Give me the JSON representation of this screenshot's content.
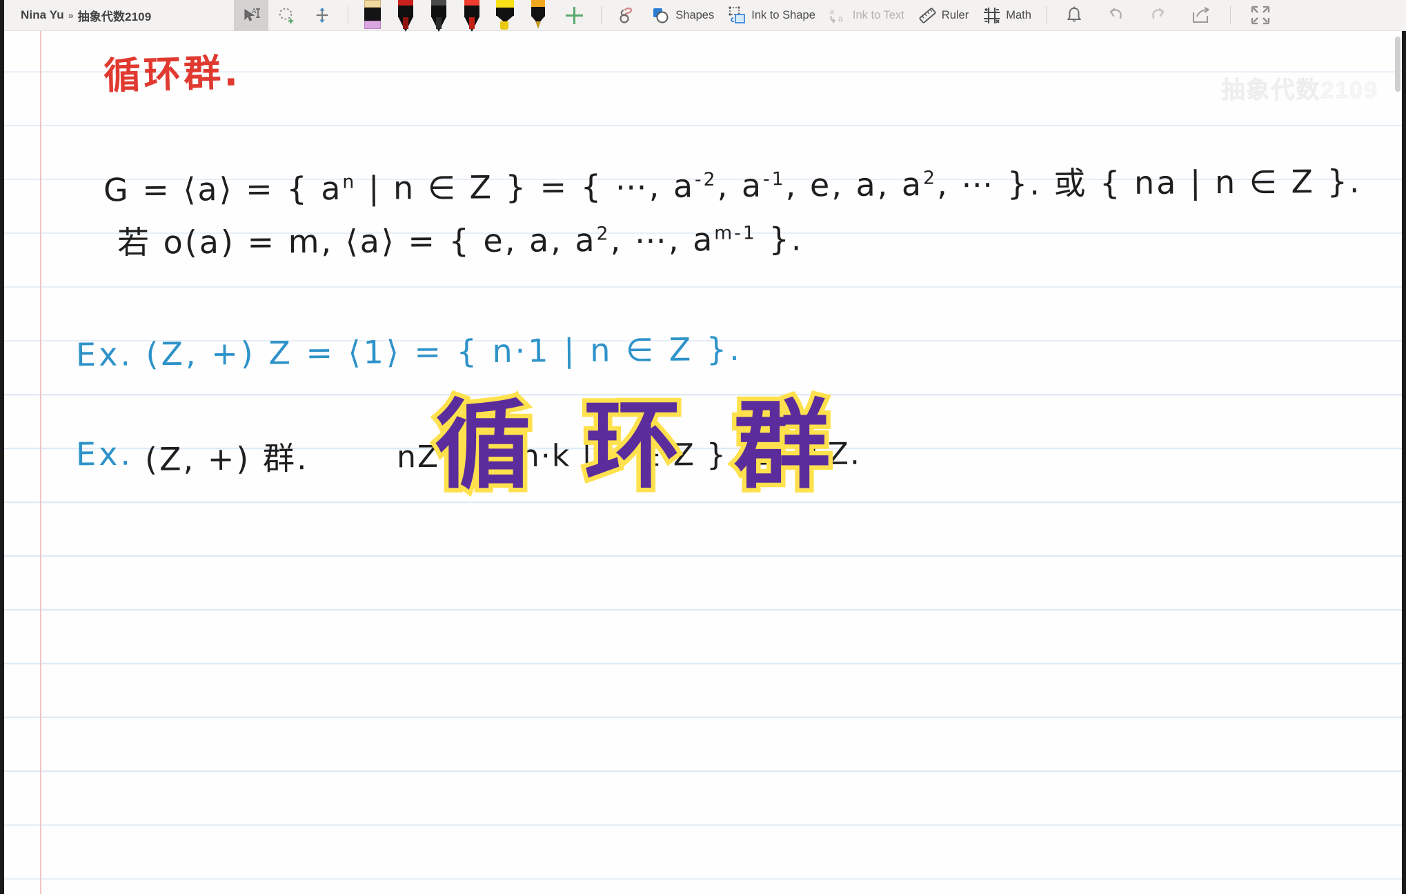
{
  "window": {
    "breadcrumb_user": "Nina Yu",
    "breadcrumb_separator": "»",
    "breadcrumb_notebook": "抽象代数2109"
  },
  "toolbar": {
    "select_tool_label": "",
    "lasso_tool_name": "lasso-select",
    "pan_tool_name": "pan-tool",
    "pens": [
      {
        "name": "eraser",
        "type": "eraser",
        "cap_color": "#f2d9a0",
        "accent_color": "#d9a6e0",
        "selected": false
      },
      {
        "name": "pen-red-1",
        "type": "pen",
        "cap_color": "#c9201c",
        "accent_color": "#8f1410",
        "selected": false
      },
      {
        "name": "pen-black",
        "type": "pen",
        "cap_color": "#4a4a4a",
        "accent_color": "#2b2b2b",
        "selected": false
      },
      {
        "name": "pen-red-2",
        "type": "pen",
        "cap_color": "#f03c2e",
        "accent_color": "#c01f14",
        "selected": false
      },
      {
        "name": "highlighter-yellow",
        "type": "highlighter",
        "cap_color": "#f7e017",
        "accent_color": "#e8c913",
        "selected": false
      },
      {
        "name": "pencil-orange",
        "type": "pencil",
        "cap_color": "#f0a81e",
        "accent_color": "#c79a2a",
        "selected": false
      }
    ],
    "add_pen_label": "+",
    "ink_effects_label": "",
    "shapes_label": "Shapes",
    "ink_to_shape_label": "Ink to Shape",
    "ink_to_text_label": "Ink to Text",
    "ink_to_text_disabled": true,
    "ruler_label": "Ruler",
    "math_label": "Math",
    "notifications_name": "bell-icon",
    "undo_label": "Undo",
    "redo_label": "Redo",
    "share_label": "Share",
    "collapse_label": "Collapse Ribbon"
  },
  "canvas": {
    "watermark": "抽象代数2109",
    "notes": {
      "title": "循环群.",
      "title_color": "#e03a30",
      "line1_pre": "G = ⟨a⟩ = { a",
      "line1_sup": "n",
      "line1_mid": " | n ∈ Z } = { ⋯, a",
      "line1_sup2": "-2",
      "line1_mid2": ", a",
      "line1_sup3": "-1",
      "line1_mid3": ", e, a, a",
      "line1_sup4": "2",
      "line1_post": ", ⋯ }. 或 { na | n ∈ Z }.",
      "line2_pre": "若 o(a) = m,   ⟨a⟩ = { e, a, a",
      "line2_sup": "2",
      "line2_mid": ", ⋯, a",
      "line2_sup2": "m-1",
      "line2_post": " }.",
      "line3": "Ex. (Z, +)    Z = ⟨1⟩ = { n·1 | n ∈ Z }.",
      "line4_blue": "Ex.",
      "line4_black": "(Z, +) 群.",
      "line4_tail": "nZ = { n·k | k ∈ Z }   nZ ◁ Z."
    },
    "overlay_title": "循 环 群",
    "overlay_fill_color": "#5b2d9c",
    "overlay_stroke_color": "#ffe14d"
  }
}
